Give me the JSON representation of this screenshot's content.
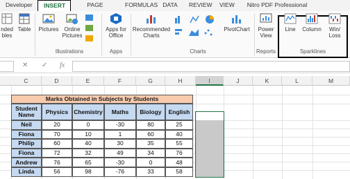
{
  "tabs": [
    "Developer",
    "INSERT",
    "PAGE LAYOUT",
    "FORMULAS",
    "DATA",
    "REVIEW",
    "VIEW",
    "Nitro PDF Professional"
  ],
  "ribbon": {
    "buttons": {
      "recommended_tables": "nded\nbles",
      "table": "Table",
      "pictures": "Pictures",
      "online_pictures": "Online\nPictures",
      "apps_for_office": "Apps for\nOffice",
      "recommended_charts": "Recommended\nCharts",
      "pivotchart": "PivotChart",
      "power_view": "Power\nView",
      "line": "Line",
      "column": "Column",
      "win_loss": "Win/\nLoss"
    },
    "groups": {
      "illustrations": "Illustrations",
      "apps": "Apps",
      "charts": "Charts",
      "reports": "Reports",
      "sparklines": "Sparklines"
    }
  },
  "formula_bar": {
    "cancel": "✕",
    "enter": "✓",
    "fx": "fx",
    "value": ""
  },
  "columns": [
    "C",
    "D",
    "E",
    "F",
    "G",
    "H",
    "I",
    "J",
    "K",
    "L",
    "M"
  ],
  "table": {
    "title": "Marks Obtained in Subjects by Students",
    "headers": [
      "Student\nName",
      "Physics",
      "Chemistry",
      "Maths",
      "Biology",
      "English"
    ],
    "rows": [
      [
        "Neil",
        "20",
        "0",
        "-30",
        "80",
        "25"
      ],
      [
        "Fiona",
        "70",
        "10",
        "1",
        "60",
        "40"
      ],
      [
        "Philip",
        "60",
        "40",
        "30",
        "35",
        "55"
      ],
      [
        "Fiona",
        "72",
        "32",
        "49",
        "34",
        "76"
      ],
      [
        "Andrew",
        "76",
        "65",
        "-30",
        "0",
        "48"
      ],
      [
        "Linda",
        "56",
        "98",
        "-76",
        "33",
        "58"
      ]
    ]
  }
}
